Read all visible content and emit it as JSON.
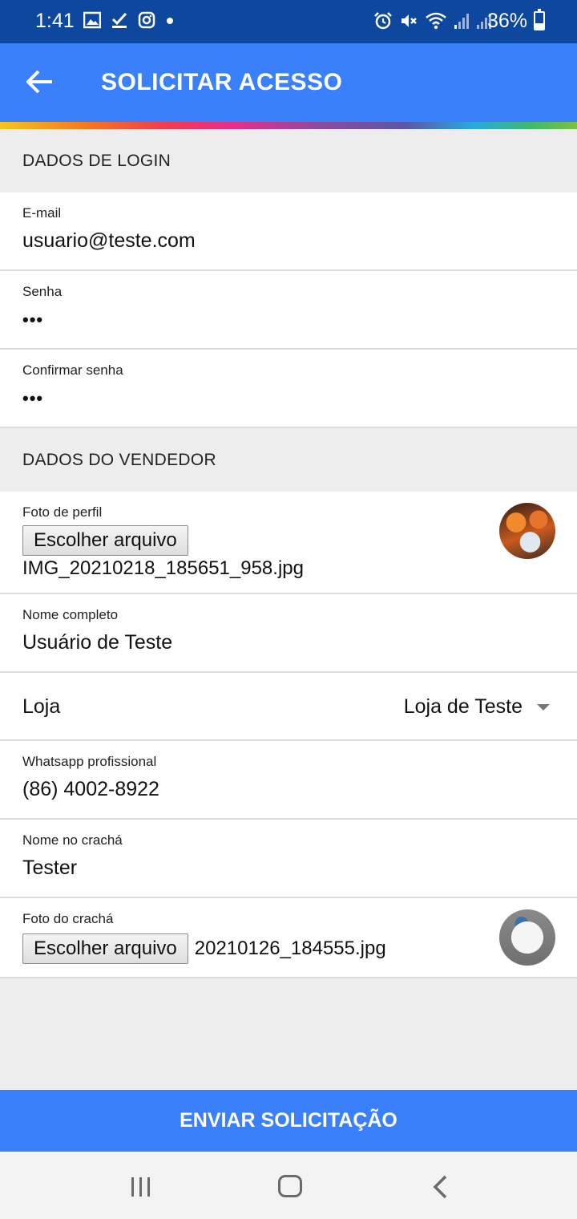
{
  "status_bar": {
    "time": "1:41",
    "battery": "36%"
  },
  "app_bar": {
    "title": "SOLICITAR ACESSO"
  },
  "login_section": {
    "header": "DADOS DE LOGIN",
    "email": {
      "label": "E-mail",
      "value": "usuario@teste.com"
    },
    "password": {
      "label": "Senha",
      "value": "•••"
    },
    "confirm_password": {
      "label": "Confirmar senha",
      "value": "•••"
    }
  },
  "seller_section": {
    "header": "DADOS DO VENDEDOR",
    "profile_photo": {
      "label": "Foto de perfil",
      "button": "Escolher arquivo",
      "file_name": "IMG_20210218_185651_958.jpg"
    },
    "full_name": {
      "label": "Nome completo",
      "value": "Usuário de Teste"
    },
    "store": {
      "label": "Loja",
      "selected": "Loja de Teste"
    },
    "whatsapp": {
      "label": "Whatsapp profissional",
      "value": "(86) 4002-8922"
    },
    "badge_name": {
      "label": "Nome no crachá",
      "value": "Tester"
    },
    "badge_photo": {
      "label": "Foto do crachá",
      "button": "Escolher arquivo",
      "file_name": "20210126_184555.jpg"
    }
  },
  "submit": {
    "label": "ENVIAR SOLICITAÇÃO"
  },
  "colors": {
    "status_bar": "#0d479e",
    "primary": "#3b80fb",
    "section_bg": "#ededed"
  }
}
